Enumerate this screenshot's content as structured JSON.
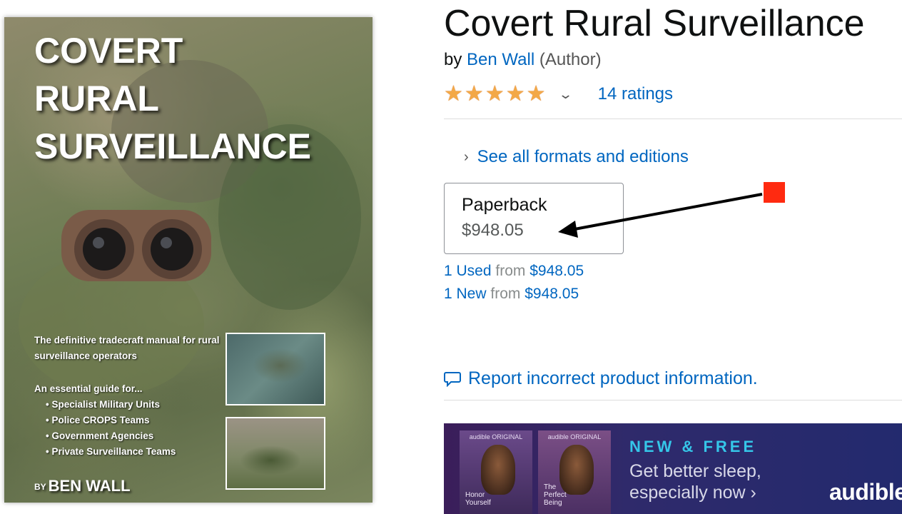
{
  "cover": {
    "title_lines": [
      "COVERT",
      "RURAL",
      "SURVEILLANCE"
    ],
    "tagline": "The definitive tradecraft manual for rural surveillance operators",
    "guide_intro": "An essential guide for...",
    "guide_items": [
      "Specialist Military Units",
      "Police CROPS Teams",
      "Government Agencies",
      "Private Surveillance Teams"
    ],
    "author_prefix": "BY",
    "author_name": "BEN WALL"
  },
  "product": {
    "title": "Covert Rural Surveillance",
    "by_label": "by",
    "author": "Ben Wall",
    "author_role": "(Author)",
    "star_rating": 5,
    "star_glyph": "★",
    "rating_chevron": "⌄",
    "ratings_text": "14 ratings",
    "formats_chevron": "›",
    "formats_link": "See all formats and editions"
  },
  "format": {
    "name": "Paperback",
    "price": "$948.05"
  },
  "offers": [
    {
      "count": "1 Used",
      "from": "from",
      "price": "$948.05"
    },
    {
      "count": "1 New",
      "from": "from",
      "price": "$948.05"
    }
  ],
  "report_link": "Report incorrect product information.",
  "banner": {
    "book1_brand": "audible ORIGINAL",
    "book1_title": "Honor Yourself",
    "book2_brand": "audible ORIGINAL",
    "book2_title": "The Perfect Being",
    "headline": "NEW & FREE",
    "line1": "Get better sleep,",
    "line2": "especially now ›",
    "logo": "audible"
  },
  "colors": {
    "link": "#0066c0",
    "star": "#f3a847",
    "annotation": "#ff2a10",
    "banner_accent": "#35c6e8"
  }
}
